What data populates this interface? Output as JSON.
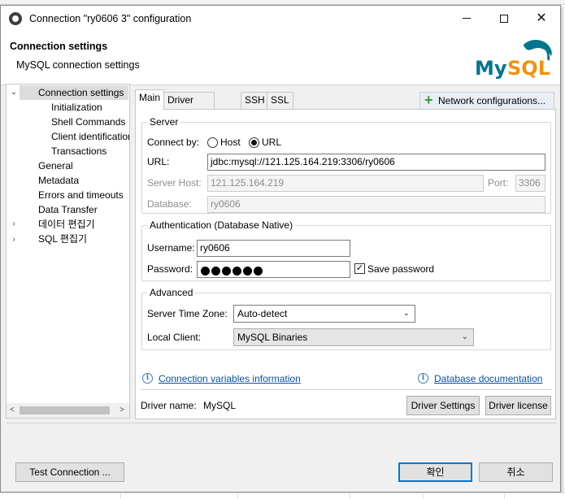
{
  "window": {
    "title": "Connection \"ry0606 3\" configuration",
    "controls": {
      "minimize": "minimize",
      "maximize": "maximize",
      "close": "✕"
    }
  },
  "header": {
    "title": "Connection settings",
    "subtitle": "MySQL connection settings",
    "logo_text": "MySQL"
  },
  "sidebar": {
    "items": [
      {
        "label": "Connection settings",
        "expanded": true,
        "selected": true
      },
      {
        "label": "Initialization"
      },
      {
        "label": "Shell Commands"
      },
      {
        "label": "Client identification"
      },
      {
        "label": "Transactions"
      },
      {
        "label": "General"
      },
      {
        "label": "Metadata"
      },
      {
        "label": "Errors and timeouts"
      },
      {
        "label": "Data Transfer"
      },
      {
        "label": "데이터 편집기"
      },
      {
        "label": "SQL 편집기"
      }
    ]
  },
  "tabs": [
    {
      "label": "Main",
      "active": true
    },
    {
      "label": "Driver properties"
    },
    {
      "label": "SSH"
    },
    {
      "label": "SSL"
    }
  ],
  "network_button": {
    "icon": "plus-icon",
    "label": "Network configurations..."
  },
  "server": {
    "legend": "Server",
    "connect_by_label": "Connect by:",
    "host_option": "Host",
    "url_option": "URL",
    "selected": "URL",
    "url_label": "URL:",
    "url_value": "jdbc:mysql://121.125.164.219:3306/ry0606",
    "host_label": "Server Host:",
    "host_value": "121.125.164.219",
    "port_label": "Port:",
    "port_value": "3306",
    "database_label": "Database:",
    "database_value": "ry0606"
  },
  "auth": {
    "legend": "Authentication (Database Native)",
    "username_label": "Username:",
    "username_value": "ry0606",
    "password_label": "Password:",
    "password_masked_length": 6,
    "save_password_label": "Save password",
    "save_password_checked": true
  },
  "advanced": {
    "legend": "Advanced",
    "timezone_label": "Server Time Zone:",
    "timezone_value": "Auto-detect",
    "client_label": "Local Client:",
    "client_value": "MySQL Binaries"
  },
  "links": {
    "conn_vars": "Connection variables information",
    "db_docs": "Database documentation"
  },
  "driver": {
    "name_label": "Driver name:",
    "name_value": "MySQL",
    "settings_button": "Driver Settings",
    "license_button": "Driver license"
  },
  "footer": {
    "test_button": "Test Connection ...",
    "ok_button": "확인",
    "cancel_button": "취소"
  },
  "colors": {
    "accent": "#0078d7",
    "link": "#0b4fa8",
    "mysql_blue": "#00758f",
    "mysql_orange": "#f29111"
  }
}
